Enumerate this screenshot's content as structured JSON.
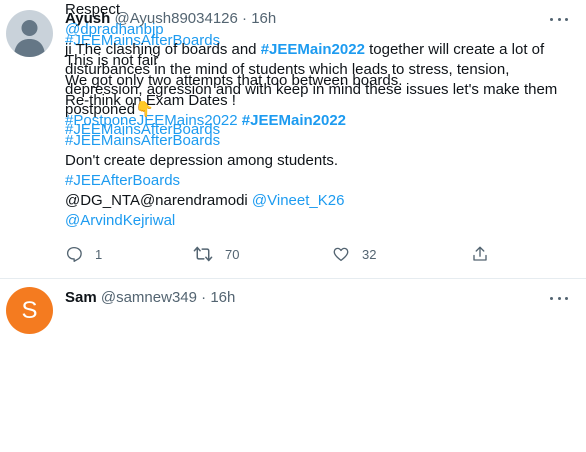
{
  "tweets": [
    {
      "name": "Ayush",
      "handle": "@Ayush89034126",
      "sep": "·",
      "time": "16h",
      "lines": [
        [
          {
            "t": "#JEEMainsAfterBoards",
            "k": "link"
          }
        ],
        [
          {
            "t": "This is not fair",
            "k": "text"
          }
        ],
        [
          {
            "t": "We got only two attempts that too between boards.",
            "k": "text"
          }
        ],
        [
          {
            "t": "Re-think on Exam Dates !",
            "k": "text"
          }
        ],
        [
          {
            "t": "#PostponeJEEMains2022",
            "k": "link"
          },
          {
            "t": " ",
            "k": "text"
          },
          {
            "t": "#JEEMain2022",
            "k": "bold-link"
          }
        ],
        [
          {
            "t": "#JEEMainsAfterBoards",
            "k": "link"
          }
        ],
        [
          {
            "t": "Don't create depression among students.",
            "k": "text"
          }
        ],
        [
          {
            "t": "#JEEAfterBoards",
            "k": "link"
          }
        ],
        [
          {
            "t": "@DG_NTA@narendramodi ",
            "k": "text"
          },
          {
            "t": "@Vineet_K26",
            "k": "link"
          }
        ],
        [
          {
            "t": " @ArvindKejriwal",
            "k": "link"
          }
        ]
      ],
      "actions": {
        "reply_count": "1",
        "retweet_count": "70",
        "like_count": "32"
      }
    },
    {
      "name": "Sam",
      "handle": "@samnew349",
      "sep": "·",
      "time": "16h",
      "avatar_letter": "S",
      "avatar_color": "#f47b20",
      "lines": [
        [
          {
            "t": "Respect",
            "k": "text"
          }
        ],
        [
          {
            "t": "@dpradhanbjp",
            "k": "link"
          }
        ],
        [
          {
            "t": " ji The clashing of boards and ",
            "k": "text"
          },
          {
            "t": "#JEEMain2022",
            "k": "bold-link"
          },
          {
            "t": " together will create a lot of",
            "k": "text"
          }
        ],
        [
          {
            "t": "disturbances in the mind of students which leads to stress, tension,",
            "k": "text"
          }
        ],
        [
          {
            "t": "depression, agression and with keep in mind these issues let's make them",
            "k": "text"
          }
        ],
        [
          {
            "t": "postponed",
            "k": "text"
          },
          {
            "t": "👇",
            "k": "emoji"
          }
        ],
        [
          {
            "t": "#JEEMainsAfterBoards",
            "k": "link"
          }
        ]
      ]
    }
  ],
  "colors": {
    "link": "#1d9bf0",
    "text": "#0f1419",
    "muted": "#536471",
    "divider": "#e6ecf0"
  },
  "icons": [
    "more-icon",
    "reply-icon",
    "retweet-icon",
    "like-icon",
    "share-icon",
    "default-avatar-icon"
  ]
}
